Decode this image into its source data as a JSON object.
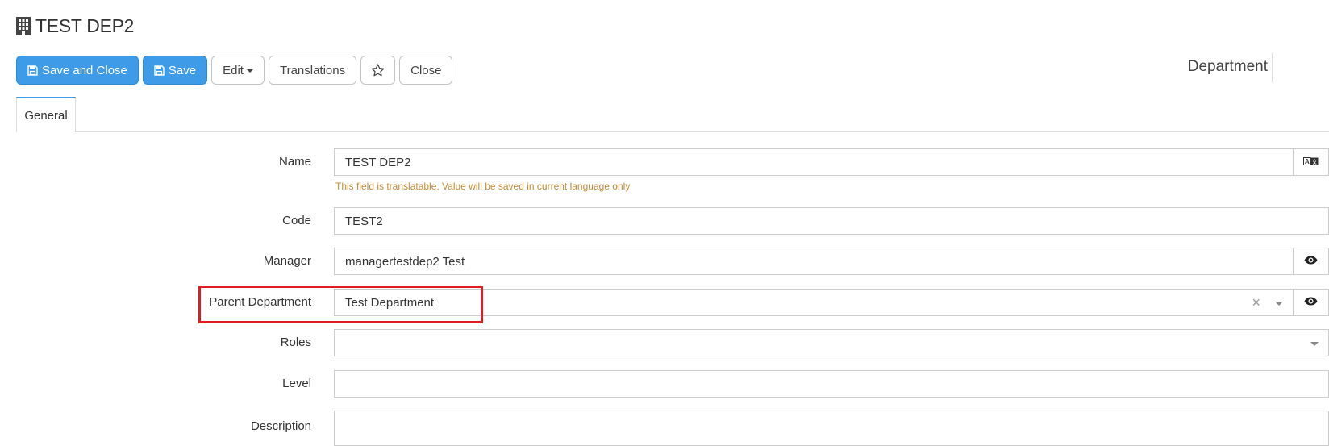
{
  "header": {
    "title": "TEST DEP2",
    "title_icon": "building-icon",
    "entity_type": "Department"
  },
  "toolbar": {
    "save_close_label": "Save and Close",
    "save_label": "Save",
    "edit_label": "Edit",
    "translations_label": "Translations",
    "favorite_icon": "star-icon",
    "close_label": "Close"
  },
  "tabs": [
    {
      "label": "General",
      "active": true
    }
  ],
  "form": {
    "name": {
      "label": "Name",
      "value": "TEST DEP2",
      "hint": "This field is translatable. Value will be saved in current language only",
      "addon_icon": "translate-icon"
    },
    "code": {
      "label": "Code",
      "value": "TEST2"
    },
    "manager": {
      "label": "Manager",
      "value": "managertestdep2 Test",
      "addon_icon": "eye-icon"
    },
    "parent_department": {
      "label": "Parent Department",
      "value": "Test Department",
      "clear_glyph": "×",
      "addon_icon": "eye-icon"
    },
    "roles": {
      "label": "Roles",
      "value": ""
    },
    "level": {
      "label": "Level",
      "value": ""
    },
    "description": {
      "label": "Description",
      "value": ""
    }
  },
  "colors": {
    "primary": "#3e9be8",
    "highlight": "#e01c24",
    "hint": "#c58a3a"
  }
}
